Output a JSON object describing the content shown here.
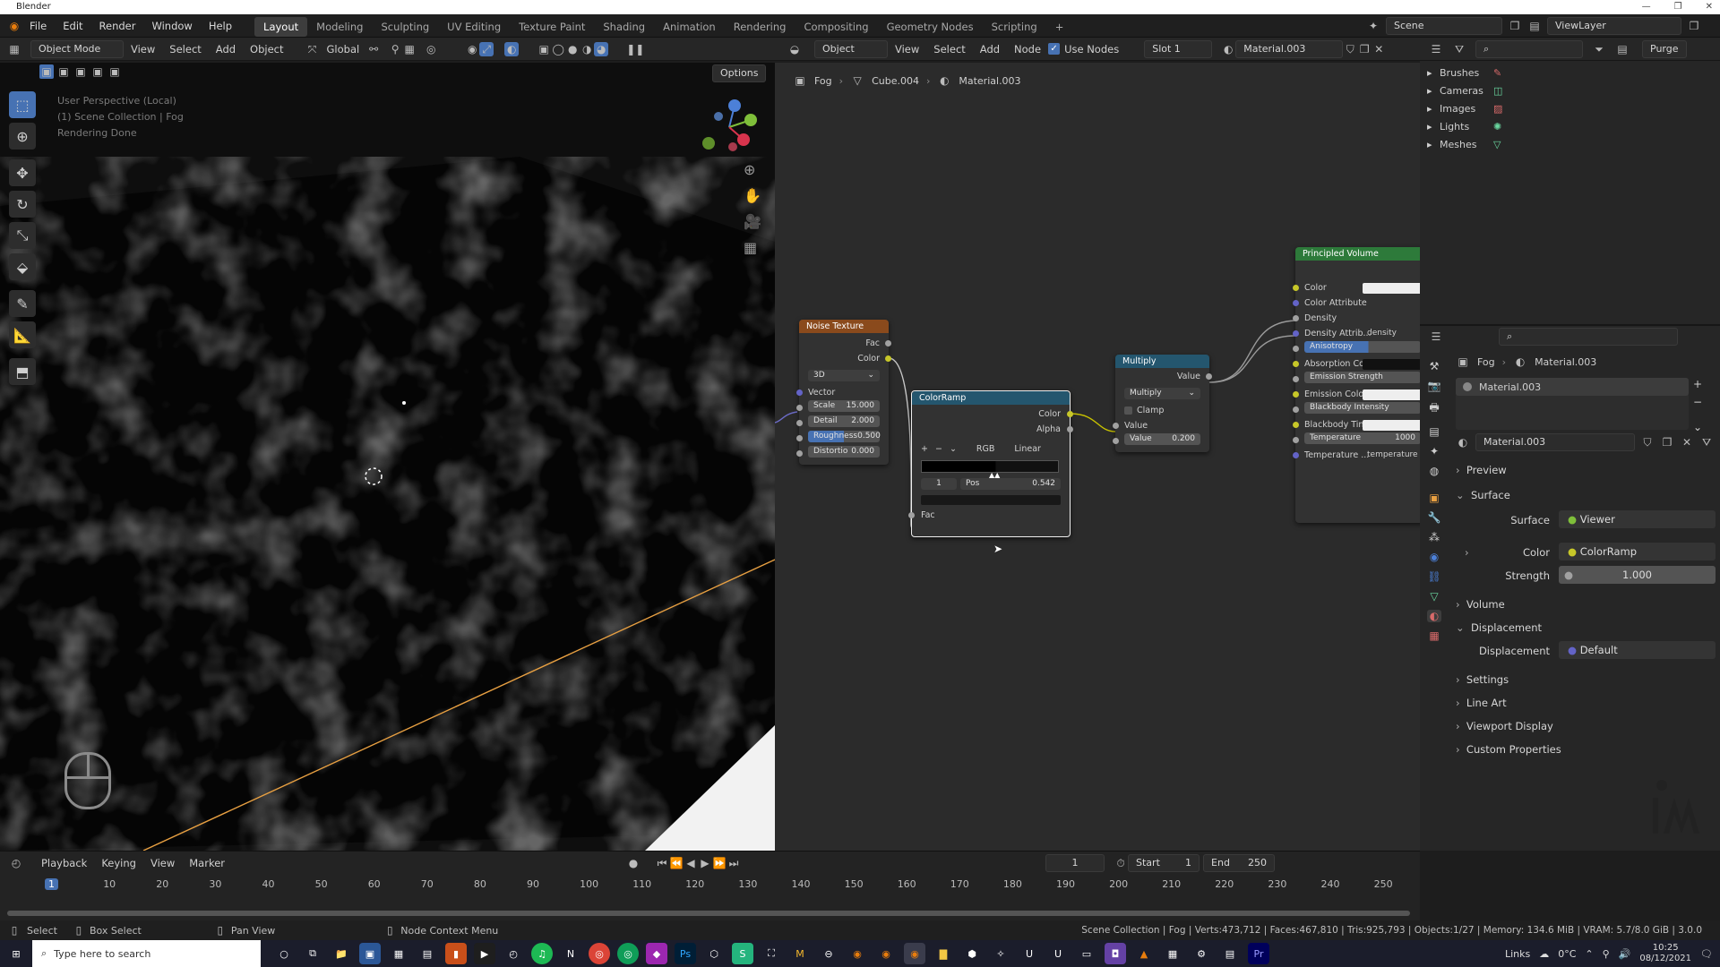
{
  "window": {
    "title": "Blender"
  },
  "menu": [
    "File",
    "Edit",
    "Render",
    "Window",
    "Help"
  ],
  "workspaces": [
    "Layout",
    "Modeling",
    "Sculpting",
    "UV Editing",
    "Texture Paint",
    "Shading",
    "Animation",
    "Rendering",
    "Compositing",
    "Geometry Nodes",
    "Scripting"
  ],
  "scene": {
    "name": "Scene",
    "view_layer": "ViewLayer"
  },
  "viewport": {
    "header": {
      "mode": "Object Mode",
      "menus": [
        "View",
        "Select",
        "Add",
        "Object"
      ],
      "orientation": "Global",
      "options": "Options"
    },
    "overlay_text": [
      "User Perspective (Local)",
      "(1) Scene Collection | Fog",
      "Rendering Done"
    ]
  },
  "node_editor": {
    "header": {
      "type": "Object",
      "menus": [
        "View",
        "Select",
        "Add",
        "Node"
      ],
      "use_nodes": "Use Nodes",
      "slot": "Slot 1",
      "material": "Material.003"
    },
    "breadcrumb": [
      "Fog",
      "Cube.004",
      "Material.003"
    ],
    "noise": {
      "title": "Noise Texture",
      "out_fac": "Fac",
      "out_color": "Color",
      "dim": "3D",
      "vector": "Vector",
      "fields": [
        {
          "label": "Scale",
          "value": "15.000"
        },
        {
          "label": "Detail",
          "value": "2.000"
        },
        {
          "label": "Roughness",
          "value": "0.500"
        },
        {
          "label": "Distortio",
          "value": "0.000"
        }
      ]
    },
    "ramp": {
      "title": "ColorRamp",
      "out_color": "Color",
      "out_alpha": "Alpha",
      "mode": "RGB",
      "interp": "Linear",
      "index": "1",
      "pos_label": "Pos",
      "pos_value": "0.542",
      "fac": "Fac"
    },
    "multiply": {
      "title": "Multiply",
      "out": "Value",
      "op": "Multiply",
      "clamp": "Clamp",
      "in_value": "Value",
      "value_label": "Value",
      "value": "0.200"
    },
    "volume": {
      "title": "Principled Volume",
      "rows": [
        "Color",
        "Color Attribute",
        "Density",
        "Density Attrib...",
        "Anisotropy",
        "Absorption Co...",
        "Emission Strength",
        "Emission Color",
        "Blackbody Intensity",
        "Blackbody Tint",
        "Temperature",
        "Temperature ..."
      ],
      "density_attr": "density",
      "temperature": "1000",
      "temperature_attr": "temperature"
    }
  },
  "outliner": {
    "items": [
      "Brushes",
      "Cameras",
      "Images",
      "Lights",
      "Meshes"
    ],
    "purge": "Purge"
  },
  "properties": {
    "breadcrumb": [
      "Fog",
      "Material.003"
    ],
    "slot": "Material.003",
    "material": "Material.003",
    "panels": {
      "preview": "Preview",
      "surface": "Surface",
      "volume": "Volume",
      "displacement": "Displacement",
      "settings": "Settings",
      "lineart": "Line Art",
      "viewport_display": "Viewport Display",
      "custom": "Custom Properties"
    },
    "surface_label": "Surface",
    "surface_value": "Viewer",
    "color_label": "Color",
    "color_value": "ColorRamp",
    "strength_label": "Strength",
    "strength_value": "1.000",
    "disp_label": "Displacement",
    "disp_value": "Default"
  },
  "timeline": {
    "menus": [
      "Playback",
      "Keying",
      "View",
      "Marker"
    ],
    "current": "1",
    "start_label": "Start",
    "start": "1",
    "end_label": "End",
    "end": "250",
    "ticks": [
      "1",
      "10",
      "20",
      "30",
      "40",
      "50",
      "60",
      "70",
      "80",
      "90",
      "100",
      "110",
      "120",
      "130",
      "140",
      "150",
      "160",
      "170",
      "180",
      "190",
      "200",
      "210",
      "220",
      "230",
      "240",
      "250"
    ]
  },
  "status": {
    "select": "Select",
    "box": "Box Select",
    "pan": "Pan View",
    "context": "Node Context Menu",
    "stats": "Scene Collection | Fog | Verts:473,712 | Faces:467,810 | Tris:925,793 | Objects:1/27 | Memory: 134.6 MiB | VRAM: 5.7/8.0 GiB | 3.0.0"
  },
  "taskbar": {
    "search": "Type here to search",
    "links": "Links",
    "temp": "0°C",
    "time": "10:25",
    "date": "08/12/2021"
  }
}
